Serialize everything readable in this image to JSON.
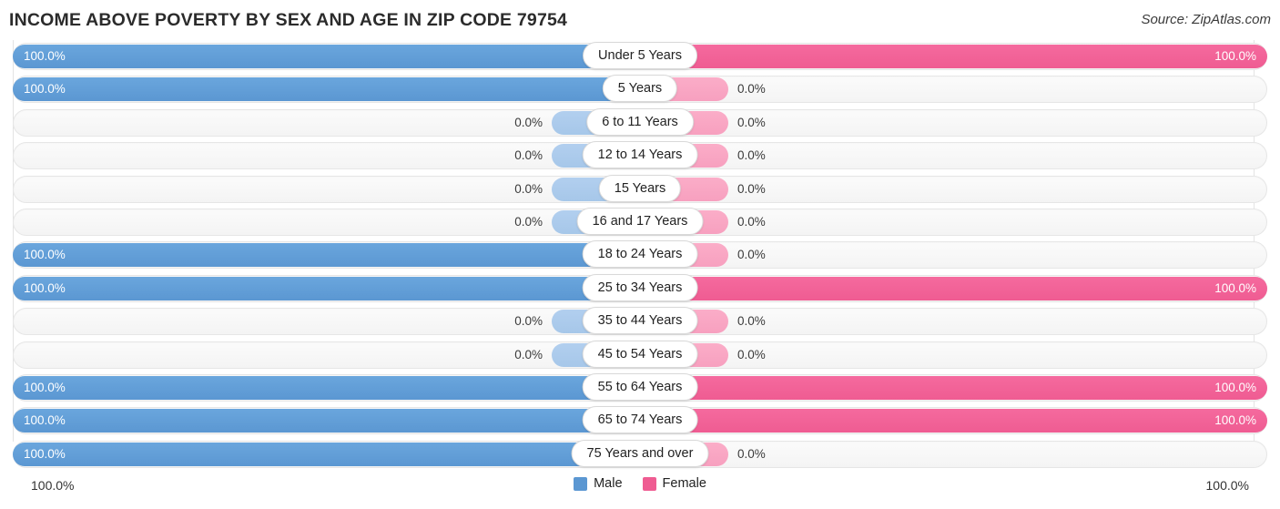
{
  "header": {
    "title": "INCOME ABOVE POVERTY BY SEX AND AGE IN ZIP CODE 79754",
    "source": "Source: ZipAtlas.com"
  },
  "legend": {
    "male_label": "Male",
    "female_label": "Female",
    "male_color": "#5b97d2",
    "female_color": "#ef5c92",
    "male_zero_color": "#a6c7e9",
    "female_zero_color": "#f7a0bf"
  },
  "axis": {
    "left_label": "100.0%",
    "right_label": "100.0%"
  },
  "chart_data": {
    "type": "bar",
    "title": "INCOME ABOVE POVERTY BY SEX AND AGE IN ZIP CODE 79754",
    "subtitle": "",
    "xlabel": "",
    "ylabel": "",
    "orientation": "horizontal-diverging",
    "xlim": [
      0,
      100
    ],
    "grid": false,
    "legend_position": "bottom-center",
    "categories": [
      "Under 5 Years",
      "5 Years",
      "6 to 11 Years",
      "12 to 14 Years",
      "15 Years",
      "16 and 17 Years",
      "18 to 24 Years",
      "25 to 34 Years",
      "35 to 44 Years",
      "45 to 54 Years",
      "55 to 64 Years",
      "65 to 74 Years",
      "75 Years and over"
    ],
    "series": [
      {
        "name": "Male",
        "values": [
          100.0,
          100.0,
          0.0,
          0.0,
          0.0,
          0.0,
          100.0,
          100.0,
          0.0,
          0.0,
          100.0,
          100.0,
          100.0
        ]
      },
      {
        "name": "Female",
        "values": [
          100.0,
          0.0,
          0.0,
          0.0,
          0.0,
          0.0,
          0.0,
          100.0,
          0.0,
          0.0,
          100.0,
          100.0,
          0.0
        ]
      }
    ],
    "rows": [
      {
        "label": "Under 5 Years",
        "male": 100.0,
        "female": 100.0,
        "male_text": "100.0%",
        "female_text": "100.0%"
      },
      {
        "label": "5 Years",
        "male": 100.0,
        "female": 0.0,
        "male_text": "100.0%",
        "female_text": "0.0%"
      },
      {
        "label": "6 to 11 Years",
        "male": 0.0,
        "female": 0.0,
        "male_text": "0.0%",
        "female_text": "0.0%"
      },
      {
        "label": "12 to 14 Years",
        "male": 0.0,
        "female": 0.0,
        "male_text": "0.0%",
        "female_text": "0.0%"
      },
      {
        "label": "15 Years",
        "male": 0.0,
        "female": 0.0,
        "male_text": "0.0%",
        "female_text": "0.0%"
      },
      {
        "label": "16 and 17 Years",
        "male": 0.0,
        "female": 0.0,
        "male_text": "0.0%",
        "female_text": "0.0%"
      },
      {
        "label": "18 to 24 Years",
        "male": 100.0,
        "female": 0.0,
        "male_text": "100.0%",
        "female_text": "0.0%"
      },
      {
        "label": "25 to 34 Years",
        "male": 100.0,
        "female": 100.0,
        "male_text": "100.0%",
        "female_text": "100.0%"
      },
      {
        "label": "35 to 44 Years",
        "male": 0.0,
        "female": 0.0,
        "male_text": "0.0%",
        "female_text": "0.0%"
      },
      {
        "label": "45 to 54 Years",
        "male": 0.0,
        "female": 0.0,
        "male_text": "0.0%",
        "female_text": "0.0%"
      },
      {
        "label": "55 to 64 Years",
        "male": 100.0,
        "female": 100.0,
        "male_text": "100.0%",
        "female_text": "100.0%"
      },
      {
        "label": "65 to 74 Years",
        "male": 100.0,
        "female": 100.0,
        "male_text": "100.0%",
        "female_text": "100.0%"
      },
      {
        "label": "75 Years and over",
        "male": 100.0,
        "female": 0.0,
        "male_text": "100.0%",
        "female_text": "0.0%"
      }
    ]
  }
}
